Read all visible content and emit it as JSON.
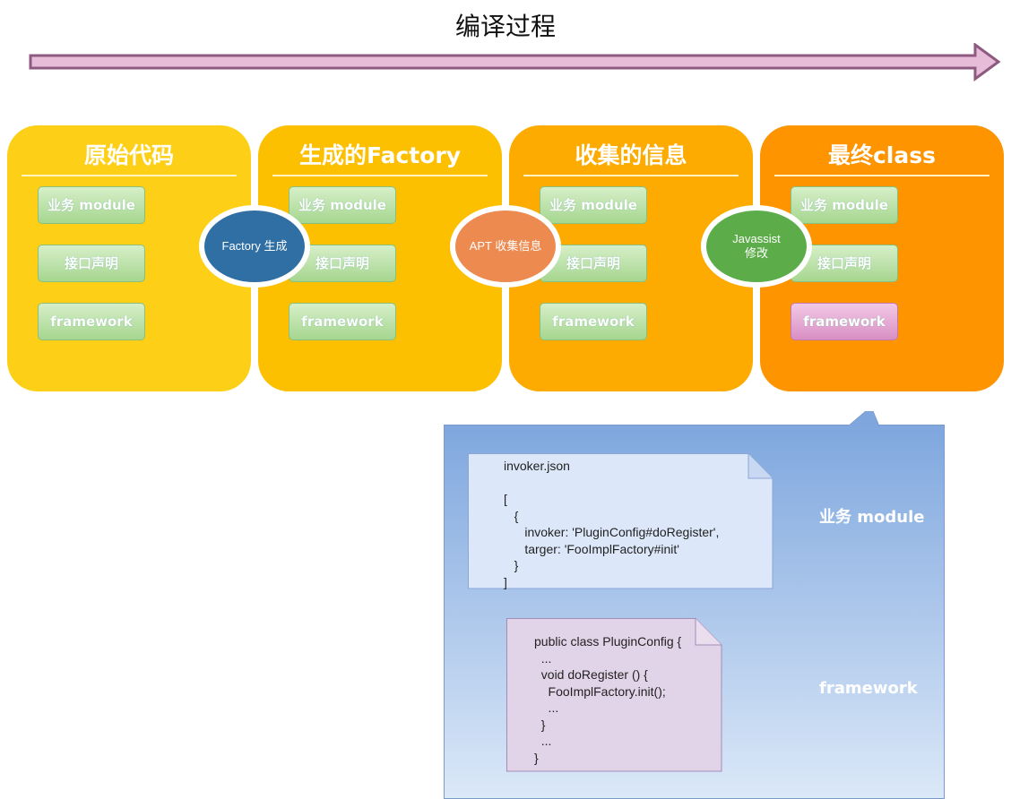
{
  "title": "编译过程",
  "colors": {
    "panel1": "#fdd017",
    "panel2": "#fdc000",
    "panel3": "#fdab00",
    "panel4": "#fd9400",
    "factory": "#2f6fa3",
    "apt": "#ec8a50",
    "javassist": "#5cad4a",
    "arrow": "#d9aacb"
  },
  "panels": [
    {
      "title": "原始代码",
      "items": [
        "业务 module",
        "接口声明",
        "framework"
      ]
    },
    {
      "title": "生成的Factory",
      "items": [
        "业务 module",
        "接口声明",
        "framework"
      ]
    },
    {
      "title": "收集的信息",
      "items": [
        "业务 module",
        "接口声明",
        "framework"
      ]
    },
    {
      "title": "最终class",
      "items": [
        "业务 module",
        "接口声明",
        "framework"
      ]
    }
  ],
  "steps": [
    "Factory 生成",
    "APT 收集信息",
    "Javassist\n修改"
  ],
  "detail": {
    "json_note": "invoker.json\n\n[\n   {\n      invoker: 'PluginConfig#doRegister',\n      targer: 'FooImplFactory#init'\n   }\n]",
    "code_note": "public class PluginConfig {\n  ...\n  void doRegister () {\n    FooImplFactory.init();\n    ...\n  }\n  ...\n}",
    "module_label": "业务 module",
    "framework_label": "framework"
  }
}
